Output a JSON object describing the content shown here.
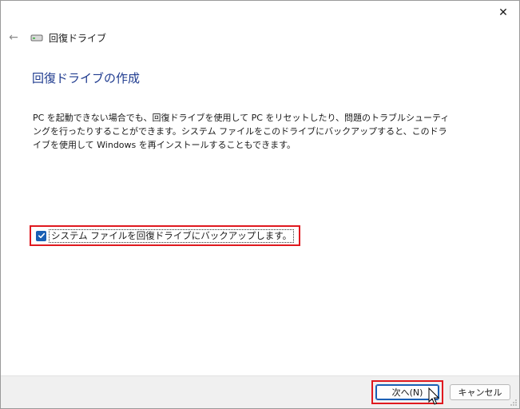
{
  "window": {
    "title": "回復ドライブ",
    "close_symbol": "✕",
    "back_symbol": "←"
  },
  "main": {
    "heading": "回復ドライブの作成",
    "description": "PC を起動できない場合でも、回復ドライブを使用して PC をリセットしたり、問題のトラブルシューティングを行ったりすることができます。システム ファイルをこのドライブにバックアップすると、このドライブを使用して Windows を再インストールすることもできます。",
    "backup_checkbox": {
      "label": "システム ファイルを回復ドライブにバックアップします。",
      "checked": true
    }
  },
  "footer": {
    "next_label": "次へ(N)",
    "cancel_label": "キャンセル"
  },
  "icons": {
    "back": "arrow-left-icon",
    "drive": "drive-icon",
    "close": "close-icon",
    "checkmark": "checkmark-icon",
    "cursor": "mouse-pointer-icon"
  },
  "colors": {
    "heading": "#1f3b8f",
    "checkbox_accent": "#1a5fb4",
    "highlight_red": "#e0191f",
    "footer_bg": "#f0f0f0"
  }
}
